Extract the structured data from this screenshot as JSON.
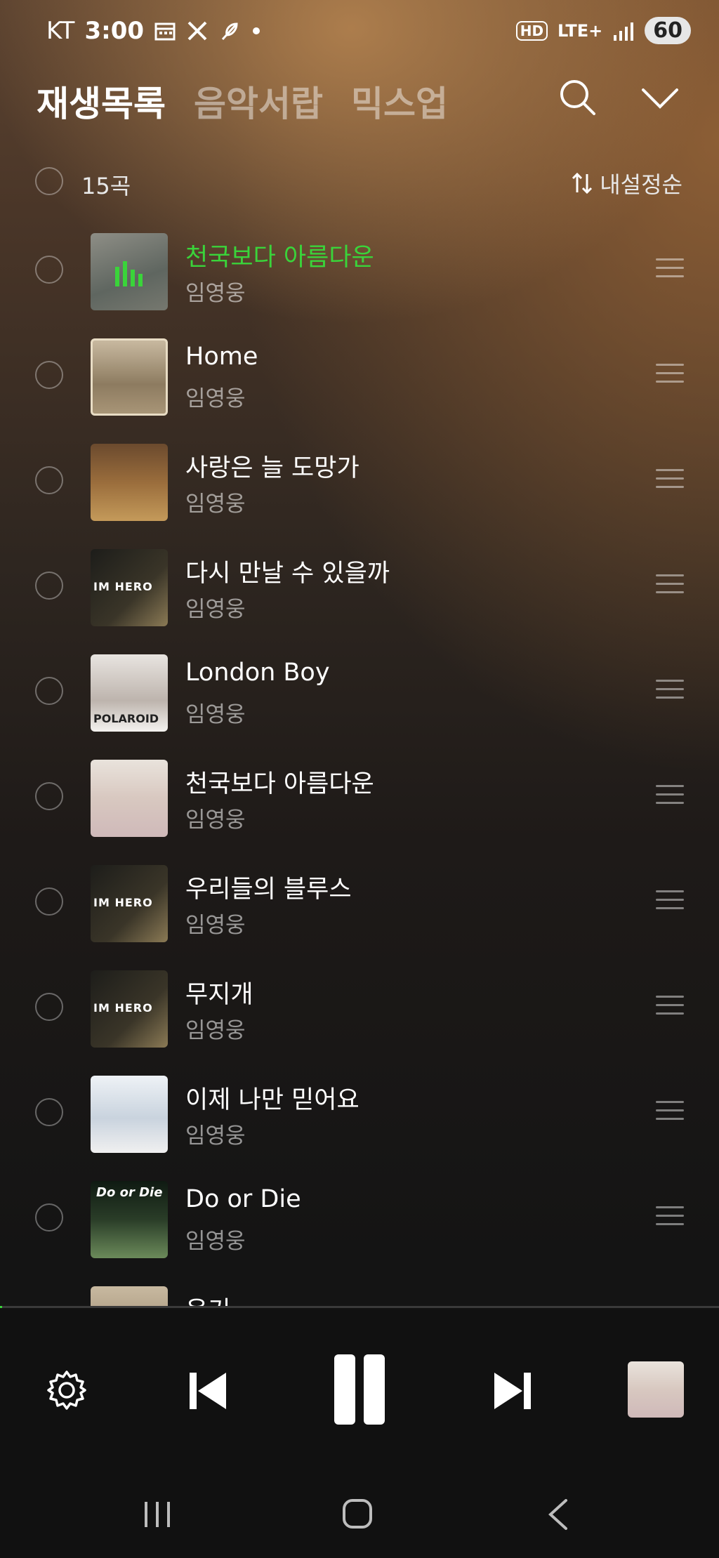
{
  "status_bar": {
    "carrier": "KT",
    "time": "3:00",
    "network": "LTE+",
    "hd": "HD",
    "battery": "60",
    "icons": [
      "calendar-icon",
      "x-icon",
      "feather-icon",
      "dot-icon",
      "signal-icon"
    ]
  },
  "tabs": [
    {
      "label": "재생목록",
      "active": true
    },
    {
      "label": "음악서랍",
      "active": false
    },
    {
      "label": "믹스업",
      "active": false
    }
  ],
  "list_header": {
    "count": "15곡",
    "sort_label": "내설정순"
  },
  "songs": [
    {
      "title": "천국보다 아름다운",
      "artist": "임영웅",
      "playing": true
    },
    {
      "title": "Home",
      "artist": "임영웅",
      "playing": false
    },
    {
      "title": "사랑은 늘 도망가",
      "artist": "임영웅",
      "playing": false
    },
    {
      "title": "다시 만날 수 있을까",
      "artist": "임영웅",
      "playing": false
    },
    {
      "title": "London Boy",
      "artist": "임영웅",
      "playing": false
    },
    {
      "title": "천국보다 아름다운",
      "artist": "임영웅",
      "playing": false
    },
    {
      "title": "우리들의 블루스",
      "artist": "임영웅",
      "playing": false
    },
    {
      "title": "무지개",
      "artist": "임영웅",
      "playing": false
    },
    {
      "title": "이제 나만 믿어요",
      "artist": "임영웅",
      "playing": false
    },
    {
      "title": "Do or Die",
      "artist": "임영웅",
      "playing": false
    },
    {
      "title": "온기",
      "artist": "",
      "playing": false
    }
  ],
  "album_art_text": {
    "im_hero": "IM HERO",
    "polaroid": "POLAROID",
    "do_or_die": "Do or Die"
  },
  "player": {
    "progress": 0.003,
    "accent_color": "#3ad43a"
  }
}
